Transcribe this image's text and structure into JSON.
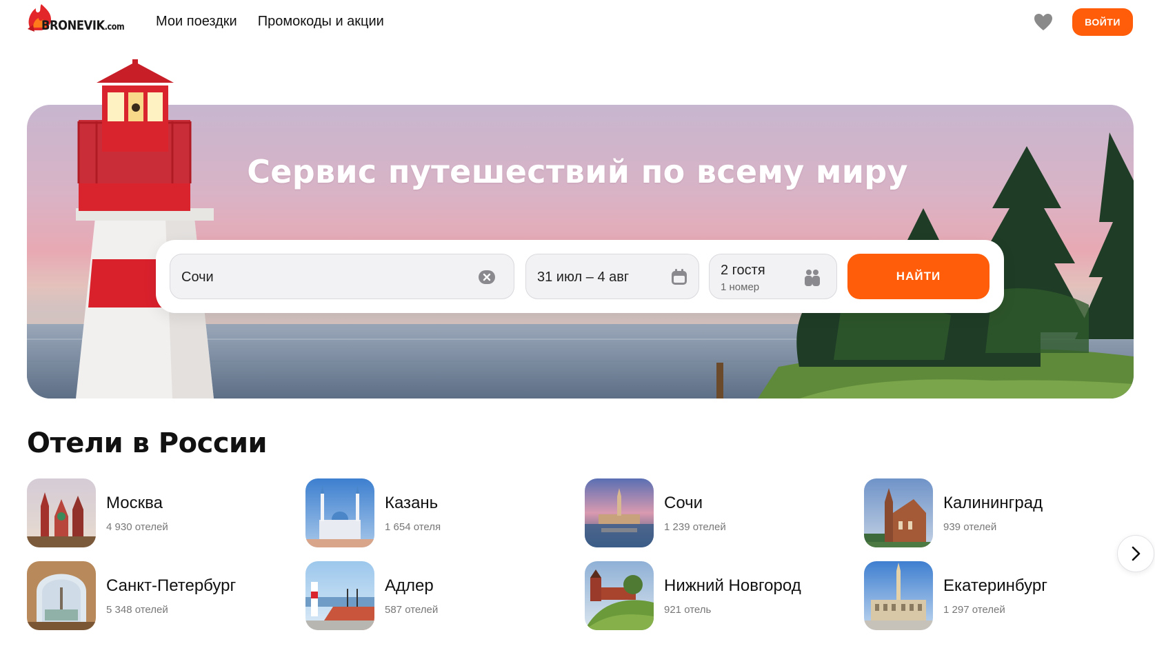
{
  "header": {
    "logo": {
      "text": "BRONEVIK",
      "domain": ".com"
    },
    "nav": [
      {
        "label": "Мои поездки"
      },
      {
        "label": "Промокоды и акции"
      }
    ],
    "favorites_icon": "heart-icon",
    "login_label": "ВОЙТИ"
  },
  "hero": {
    "title": "Сервис путешествий по всему миру"
  },
  "search": {
    "destination": {
      "value": "Сочи",
      "clear_icon": "clear-icon"
    },
    "dates": {
      "value": "31 июл – 4 авг",
      "icon": "calendar-icon"
    },
    "guests": {
      "value": "2 гостя",
      "rooms": "1 номер",
      "icon": "guests-icon"
    },
    "submit_label": "НАЙТИ"
  },
  "section": {
    "title": "Отели в России",
    "cities": [
      {
        "name": "Москва",
        "count": "4 930 отелей"
      },
      {
        "name": "Казань",
        "count": "1 654 отеля"
      },
      {
        "name": "Сочи",
        "count": "1 239 отелей"
      },
      {
        "name": "Калининград",
        "count": "939 отелей"
      },
      {
        "name": "Санкт-Петербург",
        "count": "5 348 отелей"
      },
      {
        "name": "Адлер",
        "count": "587 отелей"
      },
      {
        "name": "Нижний Новгород",
        "count": "921 отель"
      },
      {
        "name": "Екатеринбург",
        "count": "1 297 отелей"
      }
    ],
    "next_icon": "chevron-right-icon"
  },
  "colors": {
    "accent": "#ff5d0a",
    "text": "#111111",
    "muted": "#777777"
  }
}
